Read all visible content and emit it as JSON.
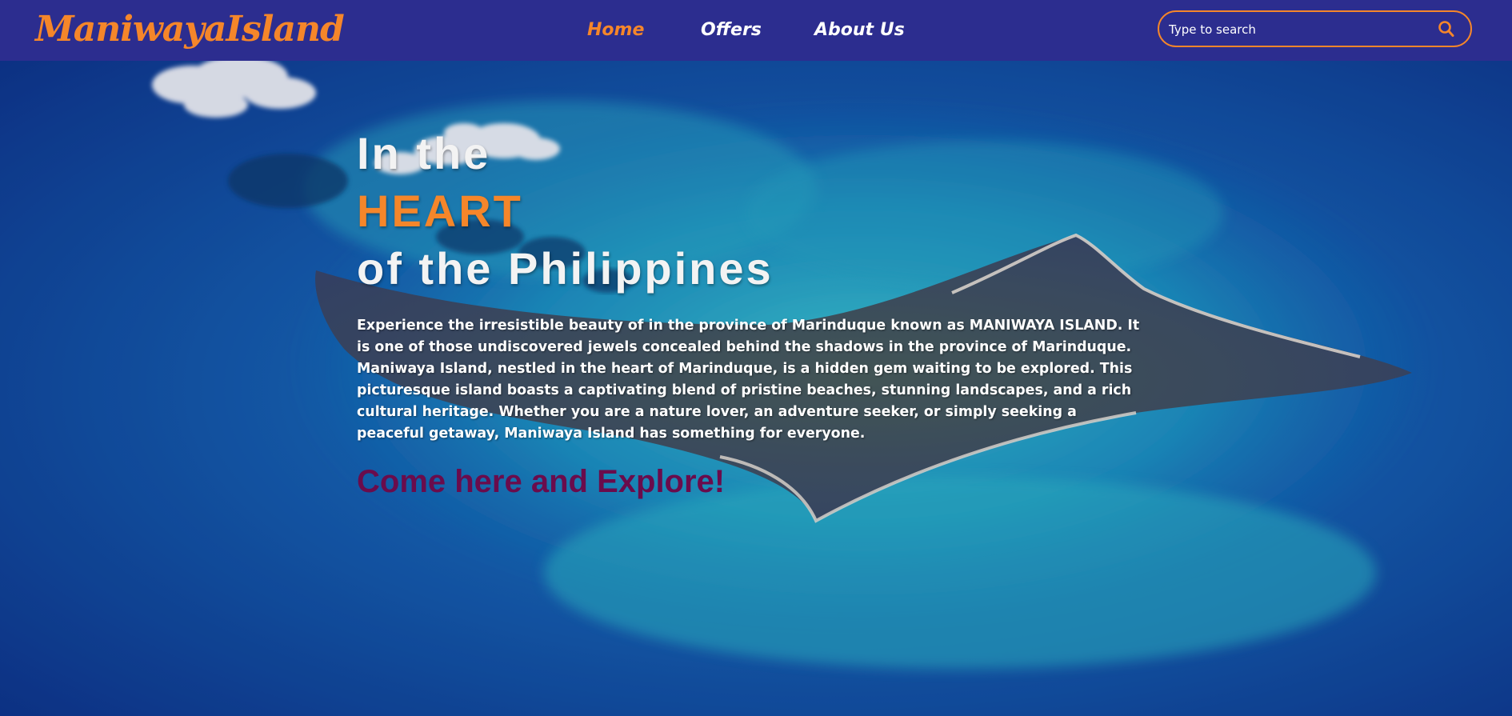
{
  "brand": {
    "logo_text": "ManiwayaIsland",
    "accent_color": "#f5862a",
    "header_color": "#2c2d8f"
  },
  "nav": {
    "items": [
      {
        "label": "Home",
        "active": true
      },
      {
        "label": "Offers",
        "active": false
      },
      {
        "label": "About Us",
        "active": false
      }
    ]
  },
  "search": {
    "placeholder": "Type to search",
    "value": "",
    "icon": "search-icon"
  },
  "hero": {
    "heading_line1": "In the",
    "heading_line2": "HEART",
    "heading_line3": "of the Philippines",
    "description": "Experience the irresistible beauty of in the province of Marinduque known as MANIWAYA ISLAND. It is one of those undiscovered jewels concealed behind the shadows in the province of Marinduque. Maniwaya Island, nestled in the heart of Marinduque, is a hidden gem waiting to be explored. This picturesque island boasts a captivating blend of pristine beaches, stunning landscapes, and a rich cultural heritage. Whether you are a nature lover, an adventure seeker, or simply seeking a peaceful getaway, Maniwaya Island has something for everyone.",
    "cta": "Come here and Explore!",
    "cta_color": "#6a0c4c"
  }
}
